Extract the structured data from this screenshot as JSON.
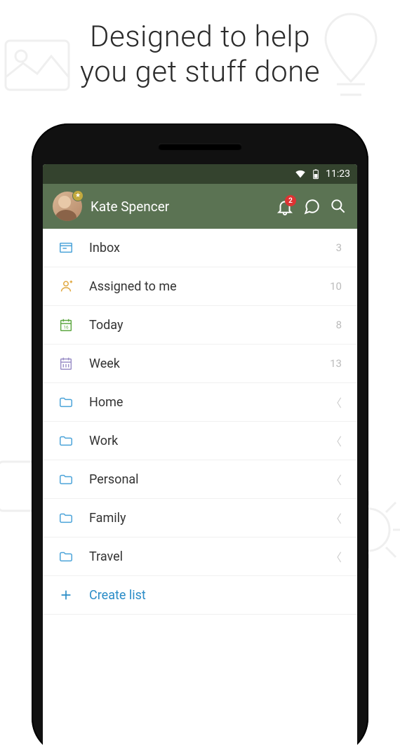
{
  "headline_l1": "Designed to help",
  "headline_l2": "you get stuff done",
  "status": {
    "time": "11:23"
  },
  "appbar": {
    "user_name": "Kate Spencer",
    "notif_count": "2"
  },
  "colors": {
    "appbar": "#5b7353",
    "status": "#34432e",
    "accent": "#2a8cc7"
  },
  "items": [
    {
      "icon": "inbox",
      "label": "Inbox",
      "meta": "3",
      "meta_type": "count"
    },
    {
      "icon": "assigned",
      "label": "Assigned to me",
      "meta": "10",
      "meta_type": "count"
    },
    {
      "icon": "today",
      "label": "Today",
      "meta": "8",
      "meta_type": "count"
    },
    {
      "icon": "week",
      "label": "Week",
      "meta": "13",
      "meta_type": "count"
    },
    {
      "icon": "folder",
      "label": "Home",
      "meta": "",
      "meta_type": "chev"
    },
    {
      "icon": "folder",
      "label": "Work",
      "meta": "",
      "meta_type": "chev"
    },
    {
      "icon": "folder",
      "label": "Personal",
      "meta": "",
      "meta_type": "chev"
    },
    {
      "icon": "folder",
      "label": "Family",
      "meta": "",
      "meta_type": "chev"
    },
    {
      "icon": "folder",
      "label": "Travel",
      "meta": "",
      "meta_type": "chev"
    }
  ],
  "create_label": "Create list"
}
